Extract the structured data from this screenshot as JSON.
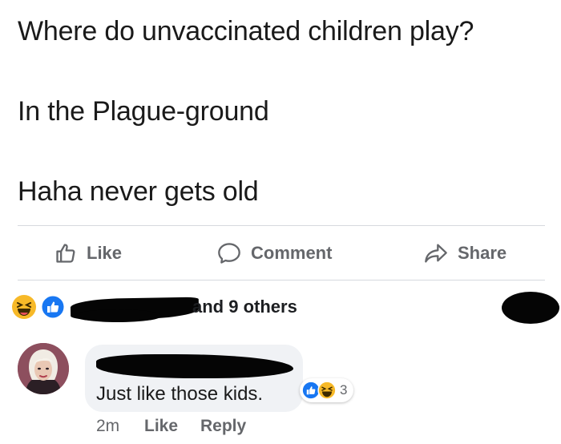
{
  "post": {
    "lines": [
      "Where do unvaccinated children play?",
      "In the Plague-ground",
      "Haha never gets old"
    ]
  },
  "actions": {
    "like_label": "Like",
    "comment_label": "Comment",
    "share_label": "Share",
    "icons": [
      "thumbs-up-icon",
      "comment-bubble-icon",
      "share-arrow-icon"
    ]
  },
  "reactions": {
    "types": [
      "haha",
      "like"
    ],
    "others_text": "and 9 others"
  },
  "comment": {
    "text": "Just like those kids.",
    "reaction_types": [
      "like",
      "haha"
    ],
    "reaction_count": "3",
    "time": "2m",
    "like_label": "Like",
    "reply_label": "Reply"
  },
  "colors": {
    "meta_gray": "#65676b",
    "like_blue": "#1877f2",
    "haha_yellow": "#f7b928",
    "bubble_bg": "#f0f2f5"
  }
}
